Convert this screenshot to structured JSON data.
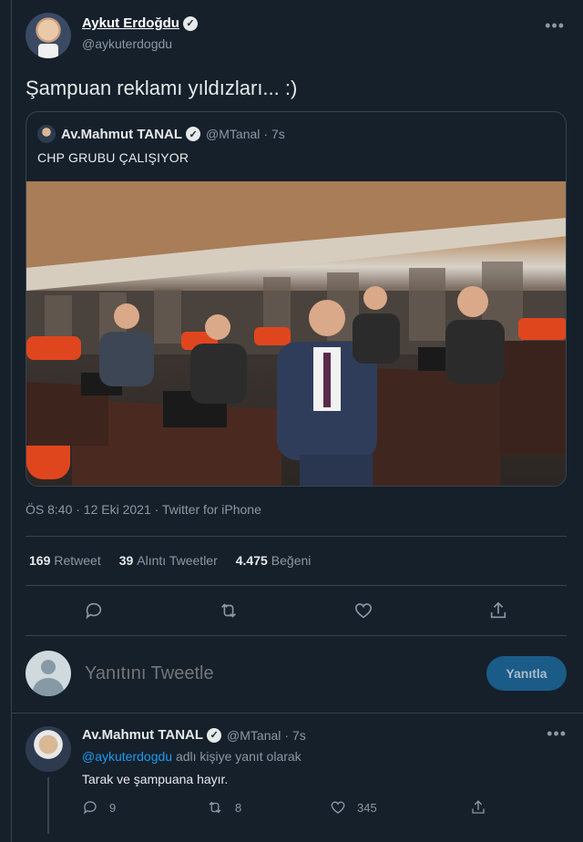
{
  "tweet": {
    "author_name": "Aykut Erdoğdu",
    "author_handle": "@aykuterdogdu",
    "text": "Şampuan reklamı yıldızları... :)",
    "quote": {
      "author_name": "Av.Mahmut TANAL",
      "author_handle": "@MTanal",
      "time": "· 7s",
      "text": "CHP GRUBU ÇALIŞIYOR"
    },
    "meta": "ÖS 8:40 · 12 Eki 2021 · Twitter for iPhone",
    "stats": {
      "retweets_count": "169",
      "retweets_label": "Retweet",
      "quotes_count": "39",
      "quotes_label": "Alıntı Tweetler",
      "likes_count": "4.475",
      "likes_label": "Beğeni"
    }
  },
  "reply_box": {
    "placeholder": "Yanıtını Tweetle",
    "button_label": "Yanıtla"
  },
  "reply": {
    "author_name": "Av.Mahmut TANAL",
    "author_handle": "@MTanal",
    "time": "· 7s",
    "reply_to_handle": "@aykuterdogdu",
    "reply_to_suffix": "adlı kişiye yanıt olarak",
    "text": "Tarak ve şampuana hayır.",
    "counts": {
      "replies": "9",
      "retweets": "8",
      "likes": "345"
    }
  },
  "colors": {
    "background": "#15202b",
    "accent": "#1d9bf0",
    "border": "#38444d"
  }
}
